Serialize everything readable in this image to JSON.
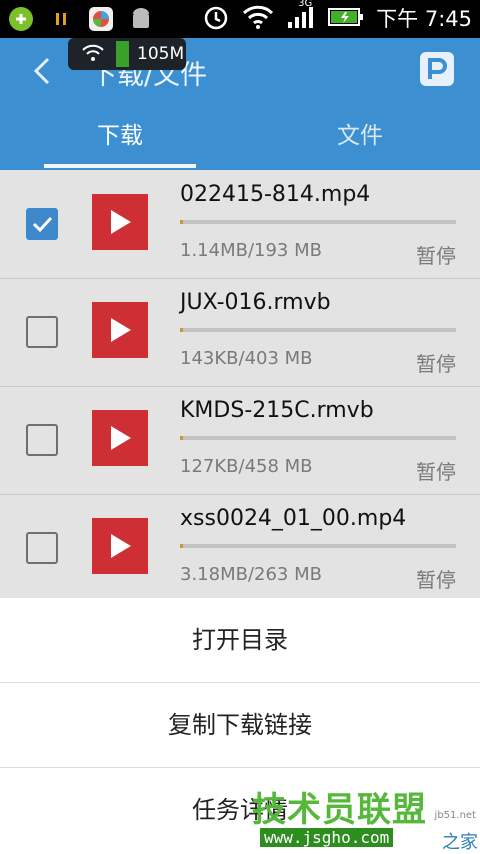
{
  "status_bar": {
    "time": "下午 7:45",
    "net_indicator": "3G",
    "icons": [
      "app-icon",
      "pause-icon",
      "store-icon",
      "android-icon",
      "alarm-icon",
      "wifi-icon",
      "signal-icon",
      "battery-icon"
    ]
  },
  "network_badge": {
    "value": "105M"
  },
  "header": {
    "title": "下载/文件"
  },
  "tabs": [
    {
      "label": "下载",
      "active": true
    },
    {
      "label": "文件",
      "active": false
    }
  ],
  "downloads": [
    {
      "name": "022415-814.mp4",
      "size": "1.14MB/193 MB",
      "action": "暂停",
      "checked": true,
      "progress": 0.006
    },
    {
      "name": "JUX-016.rmvb",
      "size": "143KB/403 MB",
      "action": "暂停",
      "checked": false,
      "progress": 0.0004
    },
    {
      "name": "KMDS-215C.rmvb",
      "size": "127KB/458 MB",
      "action": "暂停",
      "checked": false,
      "progress": 0.0003
    },
    {
      "name": "xss0024_01_00.mp4",
      "size": "3.18MB/263 MB",
      "action": "暂停",
      "checked": false,
      "progress": 0.012
    }
  ],
  "menu": {
    "items": [
      "打开目录",
      "复制下载链接",
      "任务详情"
    ]
  },
  "watermark": {
    "main": "技术员联盟",
    "url": "www.jsgho.com",
    "suffix": "之家",
    "tiny": "jb51.net"
  },
  "colors": {
    "appbar": "#3c8fd0",
    "accent_checked": "#3e88cc",
    "thumb": "#cd2f34",
    "progress": "#c99a2a"
  }
}
